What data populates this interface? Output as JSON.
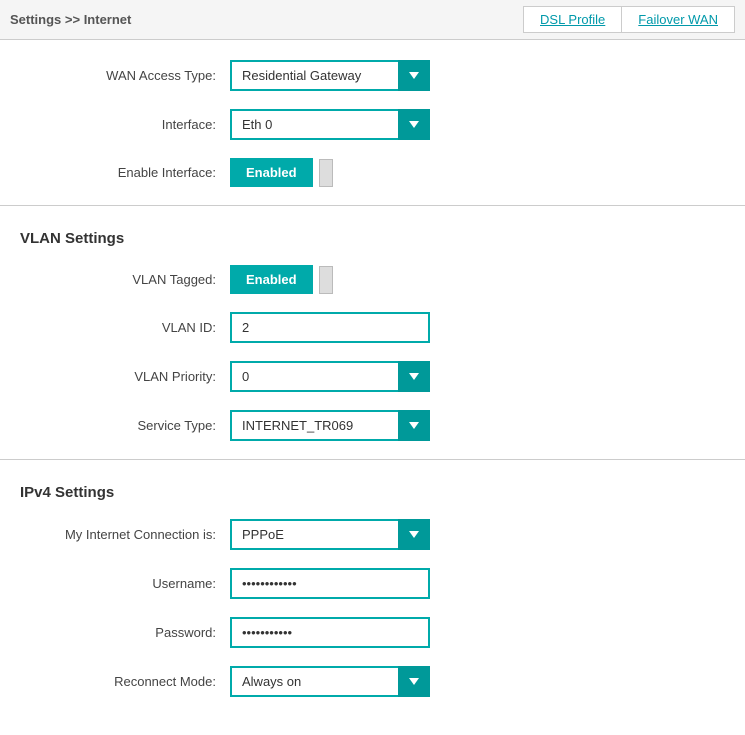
{
  "header": {
    "breadcrumb": "Settings >> Internet",
    "links": [
      {
        "label": "DSL Profile",
        "id": "dsl-profile-link"
      },
      {
        "label": "Failover WAN",
        "id": "failover-wan-link"
      }
    ]
  },
  "wan_section": {
    "wan_access_type_label": "WAN Access Type:",
    "wan_access_type_value": "Residential Gateway",
    "interface_label": "Interface:",
    "interface_value": "Eth 0",
    "enable_interface_label": "Enable Interface:",
    "enable_interface_value": "Enabled"
  },
  "vlan_section": {
    "title": "VLAN Settings",
    "vlan_tagged_label": "VLAN Tagged:",
    "vlan_tagged_value": "Enabled",
    "vlan_id_label": "VLAN ID:",
    "vlan_id_value": "2",
    "vlan_priority_label": "VLAN Priority:",
    "vlan_priority_value": "0",
    "service_type_label": "Service Type:",
    "service_type_value": "INTERNET_TR069"
  },
  "ipv4_section": {
    "title": "IPv4 Settings",
    "connection_label": "My Internet Connection is:",
    "connection_value": "PPPoE",
    "username_label": "Username:",
    "username_value": "••••••••••••",
    "password_label": "Password:",
    "password_value": "••••••••••••",
    "reconnect_label": "Reconnect Mode:",
    "reconnect_value": "Always on"
  }
}
